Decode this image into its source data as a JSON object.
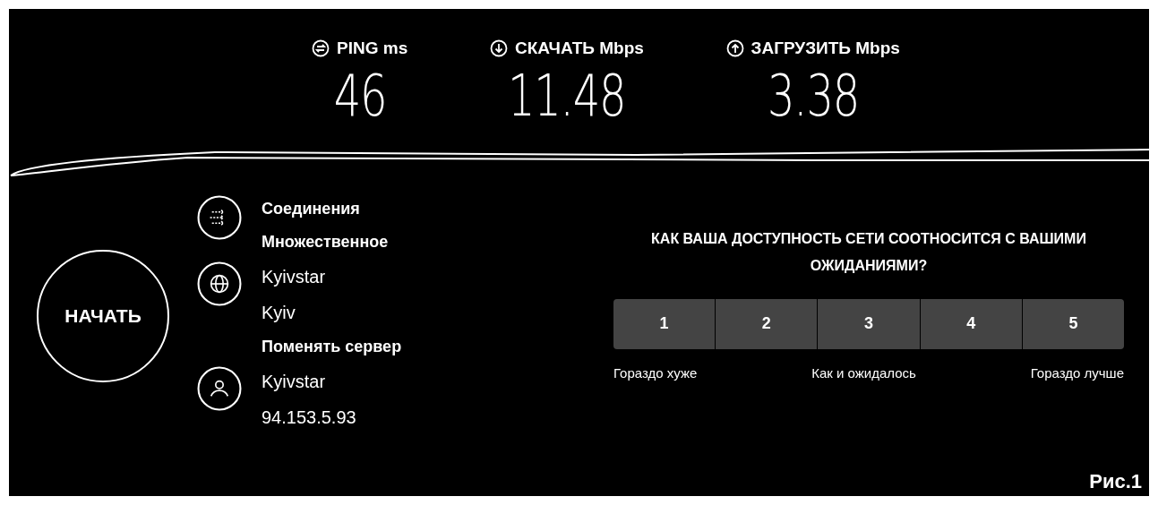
{
  "metrics": [
    {
      "kind": "ping",
      "label": "PING",
      "unit": "ms",
      "value": "46"
    },
    {
      "kind": "download",
      "label": "СКАЧАТЬ",
      "unit": "Mbps",
      "value": "11.48"
    },
    {
      "kind": "upload",
      "label": "ЗАГРУЗИТЬ",
      "unit": "Mbps",
      "value": "3.38"
    }
  ],
  "start_button": "НАЧАТЬ",
  "info": [
    {
      "kind": "connections",
      "title": "Соединения",
      "value": "Множественное"
    },
    {
      "kind": "server",
      "title": "Kyivstar",
      "value": "Kyiv",
      "link": "Поменять сервер"
    },
    {
      "kind": "provider",
      "title": "Kyivstar",
      "value": "94.153.5.93"
    }
  ],
  "survey": {
    "question": "КАК ВАША ДОСТУПНОСТЬ СЕТИ СООТНОСИТСЯ С ВАШИМИ ОЖИДАНИЯМИ?",
    "options": [
      "1",
      "2",
      "3",
      "4",
      "5"
    ],
    "scale_labels": [
      "Гораздо хуже",
      "Как и ожидалось",
      "Гораздо лучше"
    ]
  },
  "caption": "Рис.1"
}
